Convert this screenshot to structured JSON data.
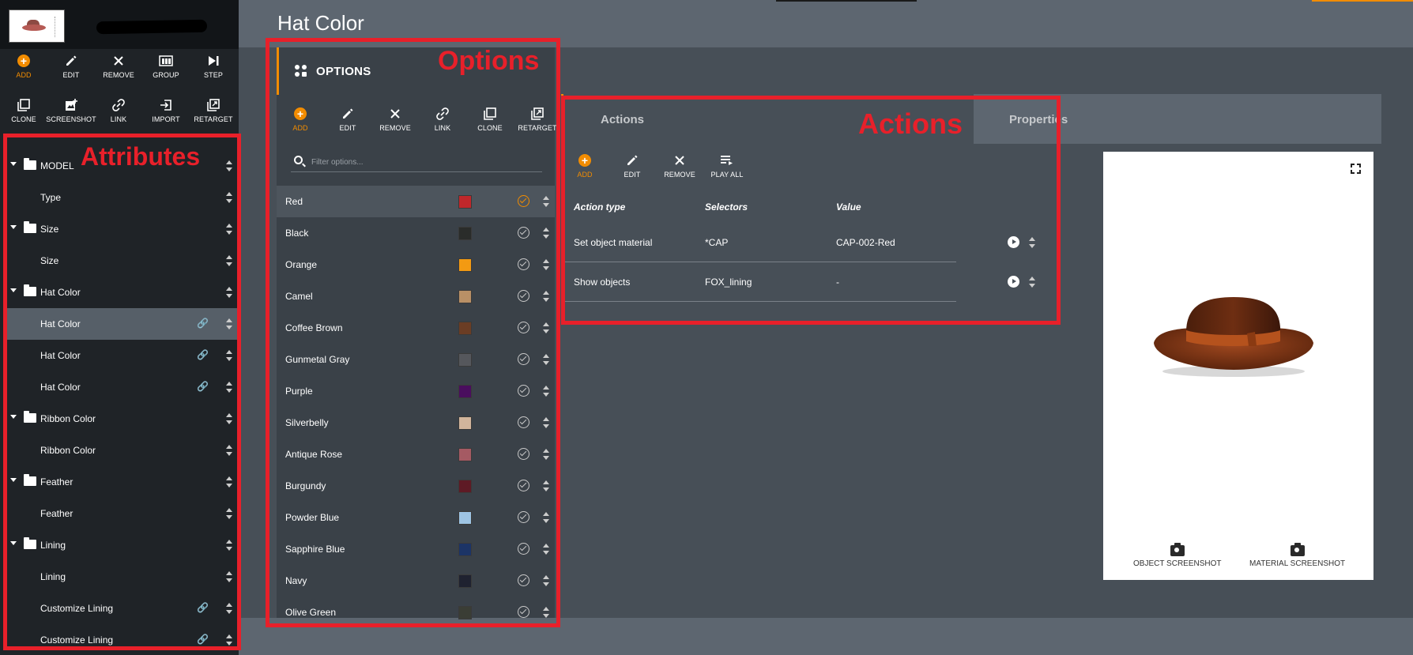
{
  "page_title": "Hat Color",
  "sidebar": {
    "toolbar_row1": [
      {
        "label": "ADD",
        "icon": "add-icon"
      },
      {
        "label": "EDIT",
        "icon": "pencil-icon"
      },
      {
        "label": "REMOVE",
        "icon": "close-icon"
      },
      {
        "label": "GROUP",
        "icon": "group-icon"
      },
      {
        "label": "STEP",
        "icon": "step-icon"
      }
    ],
    "toolbar_row2": [
      {
        "label": "CLONE",
        "icon": "clone-icon"
      },
      {
        "label": "SCREENSHOT",
        "icon": "screenshot-icon"
      },
      {
        "label": "LINK",
        "icon": "link-icon"
      },
      {
        "label": "IMPORT",
        "icon": "import-icon"
      },
      {
        "label": "RETARGET",
        "icon": "retarget-icon"
      }
    ],
    "items": [
      {
        "label": "MODEL",
        "group": true
      },
      {
        "label": "Type",
        "group": false
      },
      {
        "label": "Size",
        "group": true
      },
      {
        "label": "Size",
        "group": false
      },
      {
        "label": "Hat Color",
        "group": true
      },
      {
        "label": "Hat Color",
        "group": false,
        "link": true,
        "active": true
      },
      {
        "label": "Hat Color",
        "group": false,
        "link": true
      },
      {
        "label": "Hat Color",
        "group": false,
        "link": true
      },
      {
        "label": "Ribbon Color",
        "group": true
      },
      {
        "label": "Ribbon Color",
        "group": false
      },
      {
        "label": "Feather",
        "group": true
      },
      {
        "label": "Feather",
        "group": false
      },
      {
        "label": "Lining",
        "group": true
      },
      {
        "label": "Lining",
        "group": false
      },
      {
        "label": "Customize Lining",
        "group": false,
        "link": true
      },
      {
        "label": "Customize Lining",
        "group": false,
        "link": true
      }
    ]
  },
  "options": {
    "title": "OPTIONS",
    "toolbar": [
      {
        "label": "ADD",
        "icon": "add-icon"
      },
      {
        "label": "EDIT",
        "icon": "pencil-icon"
      },
      {
        "label": "REMOVE",
        "icon": "close-icon"
      },
      {
        "label": "LINK",
        "icon": "link-icon"
      },
      {
        "label": "CLONE",
        "icon": "clone-icon"
      },
      {
        "label": "RETARGET",
        "icon": "retarget-icon"
      }
    ],
    "filter_placeholder": "Filter options...",
    "items": [
      {
        "label": "Red",
        "color": "#c0272b",
        "active": true
      },
      {
        "label": "Black",
        "color": "#2a2c2a"
      },
      {
        "label": "Orange",
        "color": "#f39a12"
      },
      {
        "label": "Camel",
        "color": "#b99066"
      },
      {
        "label": "Coffee Brown",
        "color": "#6b3d24"
      },
      {
        "label": "Gunmetal Gray",
        "color": "#55575c"
      },
      {
        "label": "Purple",
        "color": "#4a0e5e"
      },
      {
        "label": "Silverbelly",
        "color": "#d2b59c"
      },
      {
        "label": "Antique Rose",
        "color": "#a55a63"
      },
      {
        "label": "Burgundy",
        "color": "#5e1a25"
      },
      {
        "label": "Powder Blue",
        "color": "#9ec4e4"
      },
      {
        "label": "Sapphire Blue",
        "color": "#1c3466"
      },
      {
        "label": "Navy",
        "color": "#1f2230"
      },
      {
        "label": "Olive Green",
        "color": "#3a3d35"
      }
    ]
  },
  "actions": {
    "tabs": [
      "Actions",
      "Properties"
    ],
    "toolbar": [
      {
        "label": "ADD",
        "icon": "add-icon"
      },
      {
        "label": "EDIT",
        "icon": "pencil-icon"
      },
      {
        "label": "REMOVE",
        "icon": "close-icon"
      },
      {
        "label": "PLAY ALL",
        "icon": "playlist-icon"
      }
    ],
    "columns": [
      "Action type",
      "Selectors",
      "Value"
    ],
    "rows": [
      {
        "type": "Set object material",
        "selectors": "*CAP",
        "value": "CAP-002-Red"
      },
      {
        "type": "Show objects",
        "selectors": "FOX_lining",
        "value": "-"
      }
    ]
  },
  "preview": {
    "object_screenshot_label": "OBJECT SCREENSHOT",
    "material_screenshot_label": "MATERIAL SCREENSHOT"
  },
  "annotations": {
    "attributes": "Attributes",
    "options": "Options",
    "actions": "Actions"
  },
  "colors": {
    "accent": "#f28c00",
    "annotation_red": "#e8202a",
    "sidebar_bg": "#1f2327",
    "panel_bg": "#3a4148"
  }
}
